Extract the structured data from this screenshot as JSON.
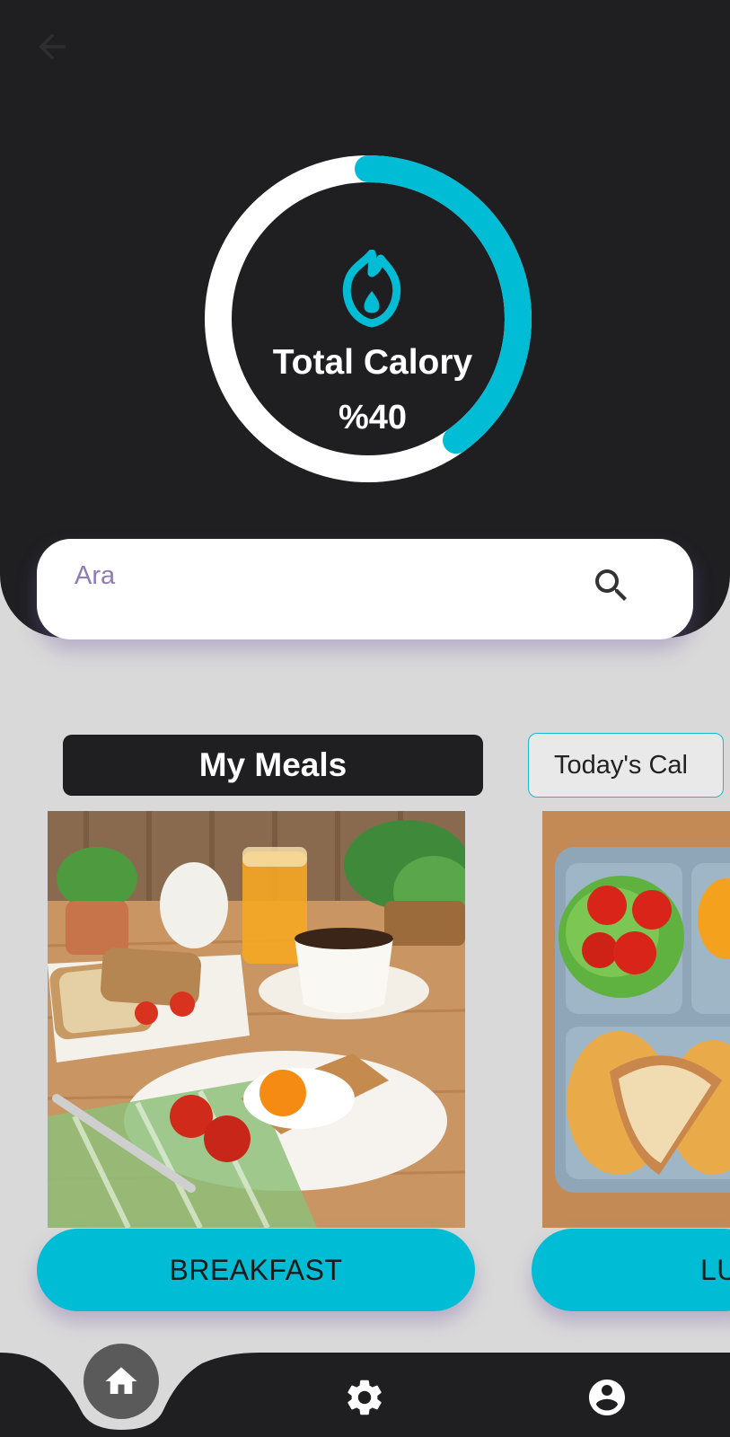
{
  "colors": {
    "dark": "#1f1f22",
    "accent": "#00bcd4",
    "background": "#d9d9d9",
    "placeholder": "#8e7bb8"
  },
  "header": {
    "back_icon": "arrow-back-icon"
  },
  "calorie_ring": {
    "icon": "fire-icon",
    "title": "Total Calory",
    "value_label": "%40",
    "progress_fraction": 0.4
  },
  "search": {
    "placeholder": "Ara",
    "icon": "search-icon"
  },
  "tabs": [
    {
      "label": "My Meals",
      "active": true
    },
    {
      "label": "Today's Cal",
      "active": false
    }
  ],
  "meals": [
    {
      "label": "BREAKFAST",
      "image": "breakfast-photo"
    },
    {
      "label": "LU",
      "image": "lunch-photo"
    }
  ],
  "bottom_nav": [
    {
      "icon": "home-icon",
      "active": true
    },
    {
      "icon": "gear-icon",
      "active": false
    },
    {
      "icon": "account-icon",
      "active": false
    }
  ]
}
